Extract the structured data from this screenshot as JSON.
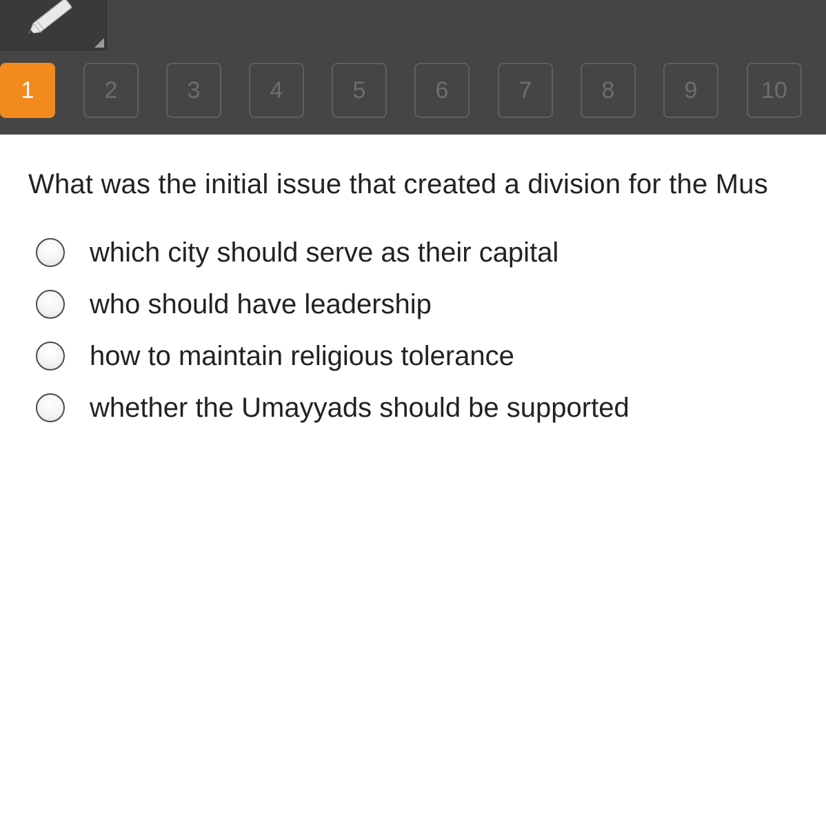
{
  "toolbar": {
    "tool_icon": "pencil-icon"
  },
  "question_nav": {
    "active_index": 0,
    "active_color": "#f28a1e",
    "items": [
      "1",
      "2",
      "3",
      "4",
      "5",
      "6",
      "7",
      "8",
      "9",
      "10"
    ]
  },
  "question": {
    "text": "What was the initial issue that created a division for the Mus"
  },
  "options": [
    {
      "label": "which city should serve as their capital"
    },
    {
      "label": "who should have leadership"
    },
    {
      "label": "how to maintain religious tolerance"
    },
    {
      "label": "whether the Umayyads should be supported"
    }
  ]
}
